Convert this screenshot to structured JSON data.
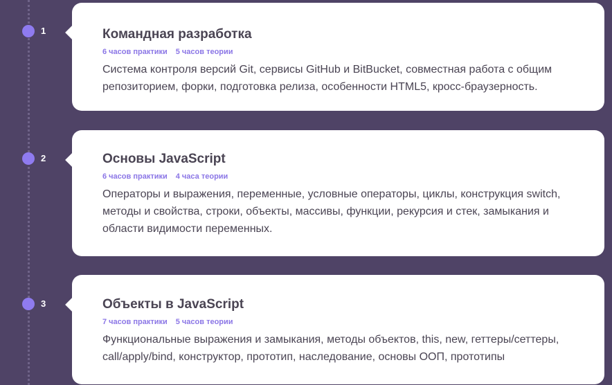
{
  "modules": [
    {
      "number": "1",
      "title": "Командная разработка",
      "practice": "6 часов практики",
      "theory": "5 часов теории",
      "description": "Система контроля версий Git, сервисы GitHub и BitBucket, совместная работа с общим репозиторием, форки, подготовка релиза, особенности HTML5, кросс-браузерность."
    },
    {
      "number": "2",
      "title": "Основы JavaScript",
      "practice": "6 часов практики",
      "theory": "4 часа теории",
      "description": "Операторы и выражения, переменные, условные операторы, циклы, конструкция switch, методы и свойства, строки, объекты, массивы, функции, рекурсия и стек, замыкания и области видимости переменных."
    },
    {
      "number": "3",
      "title": "Объекты в JavaScript",
      "practice": "7 часов практики",
      "theory": "5 часов теории",
      "description": "Функциональные выражения и замыкания, методы объектов, this, new, геттеры/сеттеры, call/apply/bind, конструктор, прототип, наследование, основы ООП, прототипы"
    }
  ],
  "colors": {
    "background": "#4f4366",
    "accent": "#8b76e6",
    "dot": "#8f7bf0",
    "card": "#ffffff",
    "text": "#4a4453"
  }
}
